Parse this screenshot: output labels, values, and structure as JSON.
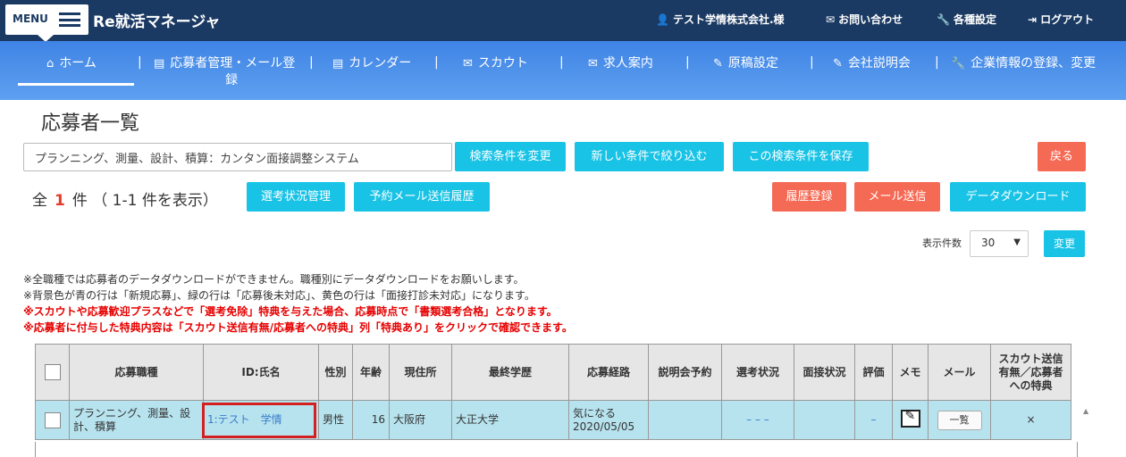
{
  "header": {
    "menu_label": "MENU",
    "brand": "Re就活マネージャ",
    "user": "テスト学情株式会社.様",
    "contact": "お問い合わせ",
    "settings": "各種設定",
    "logout": "ログアウト"
  },
  "nav": {
    "home": "ホーム",
    "applicants_line1": "応募者管理・メール登",
    "applicants_line2": "録",
    "calendar": "カレンダー",
    "scout": "スカウト",
    "jobs": "求人案内",
    "draft": "原稿設定",
    "seminar": "会社説明会",
    "company": "企業情報の登録、変更",
    "sep": "|"
  },
  "page": {
    "title": "応募者一覧",
    "search_value": "プランニング、測量、設計、積算：カンタン面接調整システム",
    "btn_change_search": "検索条件を変更",
    "btn_new_filter": "新しい条件で絞り込む",
    "btn_save_search": "この検索条件を保存",
    "btn_back": "戻る",
    "count_prefix": "全",
    "count_num": "1",
    "count_suffix": "件 （ 1-1 件を表示）",
    "btn_selection_status": "選考状況管理",
    "btn_reservation_history": "予約メール送信履歴",
    "btn_history_register": "履歴登録",
    "btn_send_mail": "メール送信",
    "btn_data_download": "データダウンロード",
    "perpage_label": "表示件数",
    "perpage_value": "30",
    "btn_change": "変更"
  },
  "notes": [
    "※全職種では応募者のデータダウンロードができません。職種別にデータダウンロードをお願いします。",
    "※背景色が青の行は「新規応募」、緑の行は「応募後未対応」、黄色の行は「面接打診未対応」になります。",
    "※スカウトや応募歓迎プラスなどで「選考免除」特典を与えた場合、応募時点で「書類選考合格」となります。",
    "※応募者に付与した特典内容は「スカウト送信有無/応募者への特典」列「特典あり」をクリックで確認できます。"
  ],
  "table": {
    "headers": {
      "job": "応募職種",
      "id_name": "ID:氏名",
      "gender": "性別",
      "age": "年齢",
      "address": "現住所",
      "school": "最終学歴",
      "route": "応募経路",
      "seminar": "説明会予約",
      "selection": "選考状況",
      "interview": "面接状況",
      "rating": "評価",
      "memo": "メモ",
      "mail": "メール",
      "scout_l1": "スカウト送信",
      "scout_l2": "有無／応募者",
      "scout_l3": "への特典"
    },
    "row": {
      "job_l1": "プランニング、測量、設",
      "job_l2": "計、積算",
      "id_name": "1:テスト　学情",
      "gender": "男性",
      "age": "16",
      "address": "大阪府",
      "school": "大正大学",
      "route_l1": "気になる",
      "route_l2": "2020/05/05",
      "seminar": "",
      "selection": "– – –",
      "interview": "",
      "rating": "–",
      "mail_btn": "一覧",
      "scout": "×"
    }
  },
  "colors": {
    "header_bg": "#1b3a63",
    "nav_bg": "#4a8ee9",
    "cyan": "#19c3e6",
    "red": "#f56a55",
    "row_bg": "#b7e3ee"
  }
}
